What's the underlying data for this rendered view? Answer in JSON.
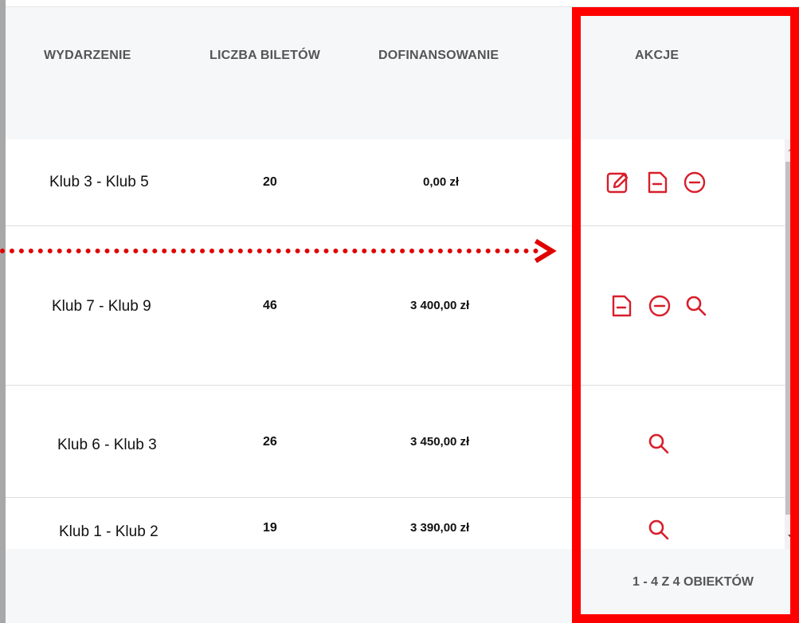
{
  "table": {
    "columns": [
      "WYDARZENIE",
      "LICZBA BILETÓW",
      "DOFINANSOWANIE",
      "AKCJE"
    ],
    "rows": [
      {
        "event": "Klub 3 - Klub 5",
        "tickets": "20",
        "funding": "0,00 zł",
        "actions": [
          "edit-icon",
          "document-icon",
          "minus-circle-icon"
        ]
      },
      {
        "event": "Klub 7 - Klub 9",
        "tickets": "46",
        "funding": "3 400,00 zł",
        "actions": [
          "document-icon",
          "minus-circle-icon",
          "search-icon"
        ]
      },
      {
        "event": "Klub 6 - Klub 3",
        "tickets": "26",
        "funding": "3 450,00 zł",
        "actions": [
          "search-icon"
        ]
      },
      {
        "event": "Klub 1 - Klub 2",
        "tickets": "19",
        "funding": "3 390,00 zł",
        "actions": [
          "search-icon"
        ]
      }
    ]
  },
  "pager": {
    "text": "1 - 4 Z 4 OBIEKTÓW"
  },
  "colors": {
    "icon": "#d81e2a",
    "highlight": "#ff0000",
    "header_bg": "#f6f7f9"
  }
}
